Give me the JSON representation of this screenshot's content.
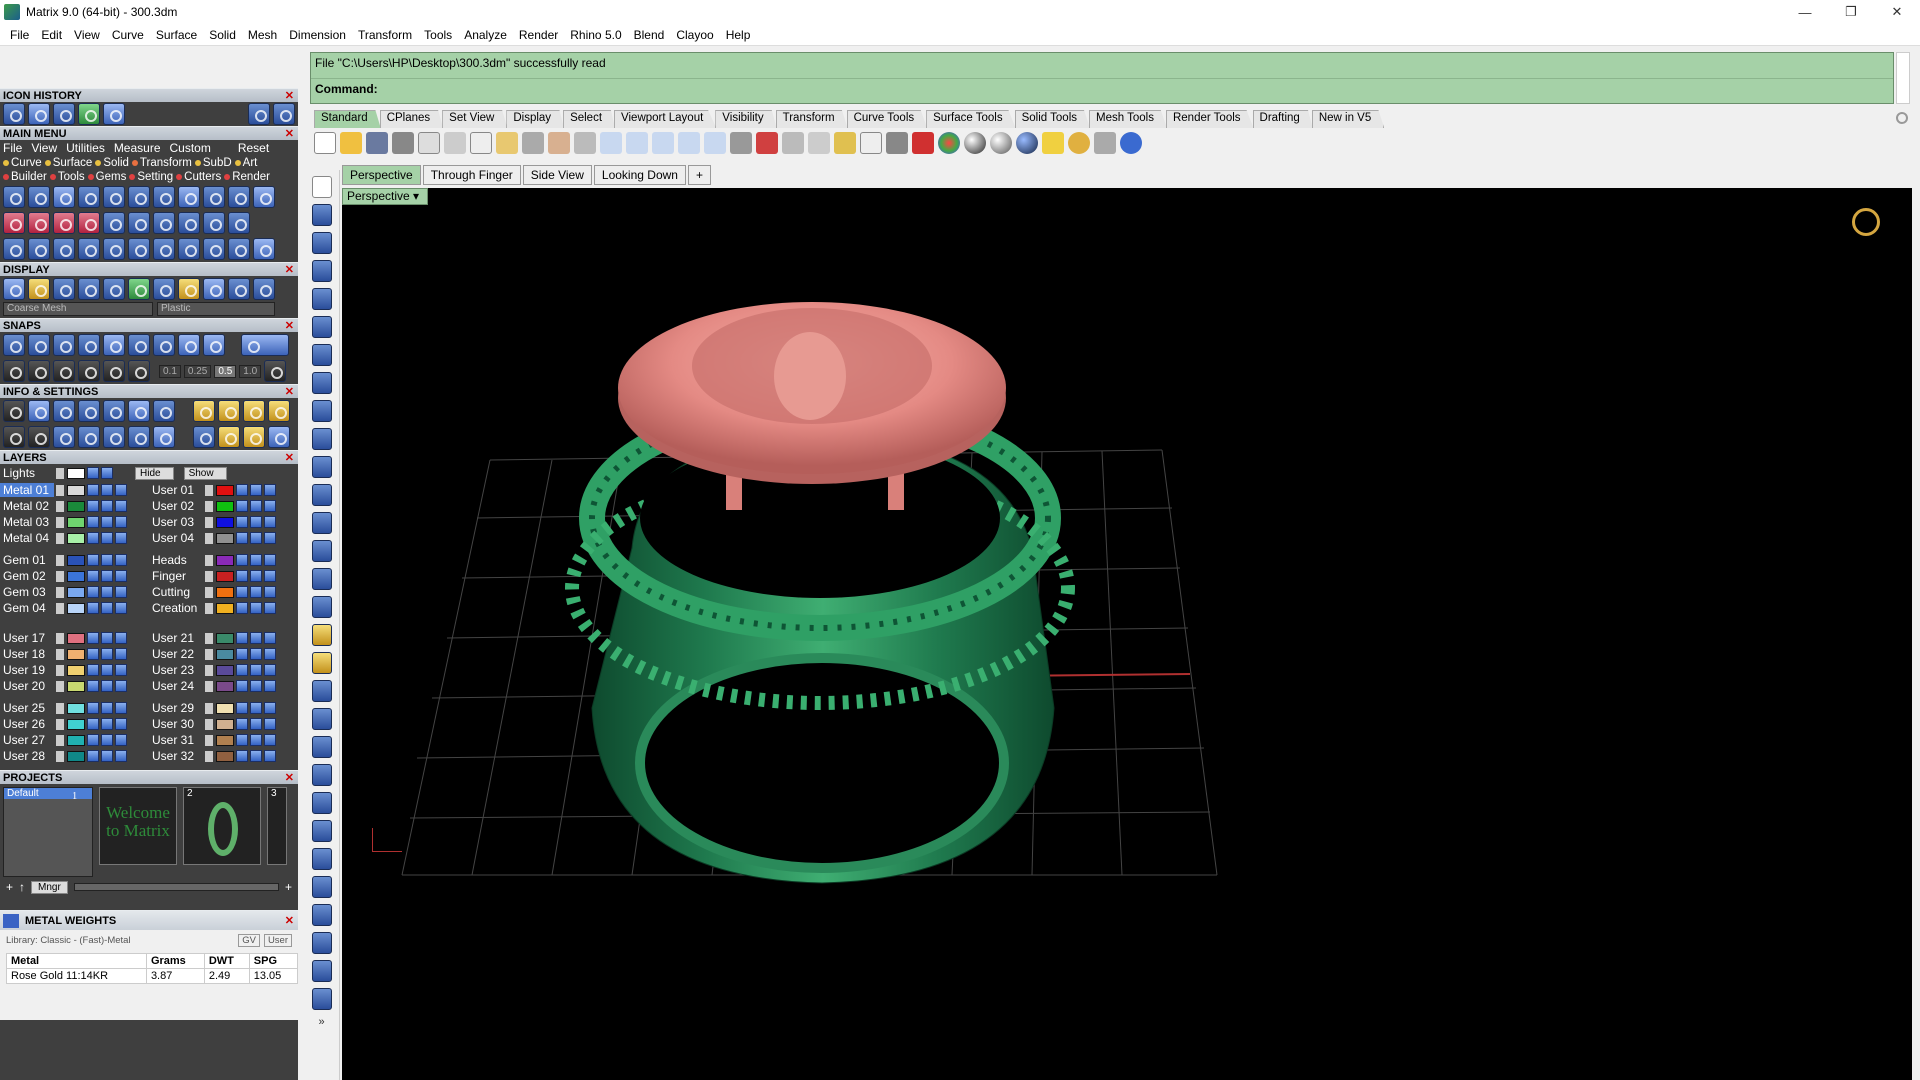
{
  "window": {
    "title": "Matrix 9.0 (64-bit) - 300.3dm"
  },
  "menubar": [
    "File",
    "Edit",
    "View",
    "Curve",
    "Surface",
    "Solid",
    "Mesh",
    "Dimension",
    "Transform",
    "Tools",
    "Analyze",
    "Render",
    "Rhino 5.0",
    "Blend",
    "Clayoo",
    "Help"
  ],
  "command": {
    "history": "File \"C:\\Users\\HP\\Desktop\\300.3dm\" successfully read",
    "prompt": "Command:"
  },
  "tool_tabs": [
    "Standard",
    "CPlanes",
    "Set View",
    "Display",
    "Select",
    "Viewport Layout",
    "Visibility",
    "Transform",
    "Curve Tools",
    "Surface Tools",
    "Solid Tools",
    "Mesh Tools",
    "Render Tools",
    "Drafting",
    "New in V5"
  ],
  "viewport_tabs": [
    "Perspective",
    "Through Finger",
    "Side View",
    "Looking Down"
  ],
  "viewport_label": "Perspective",
  "panels": {
    "icon_history": "ICON HISTORY",
    "main_menu": "MAIN MENU",
    "display": "DISPLAY",
    "snaps": "SNAPS",
    "info_settings": "INFO & SETTINGS",
    "layers": "LAYERS",
    "projects": "PROJECTS",
    "metal_weights": "METAL WEIGHTS"
  },
  "main_menu": {
    "row1": [
      "File",
      "View",
      "Utilities",
      "Measure",
      "Custom",
      "Reset"
    ],
    "row2": [
      "Curve",
      "Surface",
      "Solid",
      "Transform",
      "SubD",
      "Art"
    ],
    "row3": [
      "Builder",
      "Tools",
      "Gems",
      "Setting",
      "Cutters",
      "Render"
    ]
  },
  "display": {
    "mesh": "Coarse Mesh",
    "material": "Plastic"
  },
  "snaps": {
    "values": [
      "0.1",
      "0.25",
      "0.5",
      "1.0"
    ]
  },
  "layers": {
    "lights": "Lights",
    "hide": "Hide",
    "show": "Show",
    "left": [
      {
        "name": "Metal 01",
        "color": "#d9d9d9",
        "selected": true
      },
      {
        "name": "Metal 02",
        "color": "#1a8a3a"
      },
      {
        "name": "Metal 03",
        "color": "#6fd46f"
      },
      {
        "name": "Metal 04",
        "color": "#a8f0a8"
      },
      {
        "name": "Gem 01",
        "color": "#2a52b8"
      },
      {
        "name": "Gem 02",
        "color": "#3b74d8"
      },
      {
        "name": "Gem 03",
        "color": "#7aa8f0"
      },
      {
        "name": "Gem 04",
        "color": "#b8d4f8"
      },
      {
        "name": "User 17",
        "color": "#e07080"
      },
      {
        "name": "User 18",
        "color": "#f0b070"
      },
      {
        "name": "User 19",
        "color": "#f0d070"
      },
      {
        "name": "User 20",
        "color": "#c8d870"
      },
      {
        "name": "User 25",
        "color": "#70e0e0"
      },
      {
        "name": "User 26",
        "color": "#40d0d0"
      },
      {
        "name": "User 27",
        "color": "#20b0b0"
      },
      {
        "name": "User 28",
        "color": "#108888"
      }
    ],
    "right": [
      {
        "name": "User 01",
        "color": "#e01010"
      },
      {
        "name": "User 02",
        "color": "#10c010"
      },
      {
        "name": "User 03",
        "color": "#1010e0"
      },
      {
        "name": "User 04",
        "color": "#909090"
      },
      {
        "name": "Heads",
        "color": "#8a2ab8"
      },
      {
        "name": "Finger",
        "color": "#c82020"
      },
      {
        "name": "Cutting",
        "color": "#f07010"
      },
      {
        "name": "Creation",
        "color": "#f0b020"
      },
      {
        "name": "User 21",
        "color": "#3a8a6a"
      },
      {
        "name": "User 22",
        "color": "#4a8aa0"
      },
      {
        "name": "User 23",
        "color": "#5a4a9a"
      },
      {
        "name": "User 24",
        "color": "#7a4a8a"
      },
      {
        "name": "User 29",
        "color": "#f0e0b0"
      },
      {
        "name": "User 30",
        "color": "#d0b090"
      },
      {
        "name": "User 31",
        "color": "#b08050"
      },
      {
        "name": "User 32",
        "color": "#906040"
      }
    ]
  },
  "projects": {
    "list": [
      "Default"
    ],
    "thumbs": [
      "1",
      "2",
      "3"
    ],
    "thumb1_text": "Welcome to Matrix",
    "mngr": "Mngr"
  },
  "metal": {
    "library": "Library: Classic - (Fast)-Metal",
    "gv": "GV",
    "user": "User",
    "headers": [
      "Metal",
      "Grams",
      "DWT",
      "SPG"
    ],
    "rows": [
      [
        "Rose Gold 11:14KR",
        "3.87",
        "2.49",
        "13.05"
      ]
    ]
  },
  "colors": {
    "green_ring": "#1f7a4e",
    "pink_top": "#e48a84",
    "cmd_green": "#a5d1a7"
  }
}
